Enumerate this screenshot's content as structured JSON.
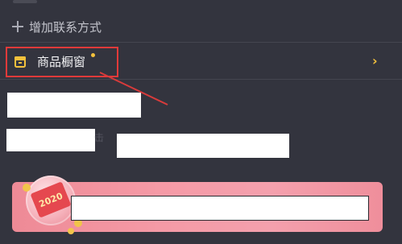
{
  "contact": {
    "add_label": "增加联系方式"
  },
  "shop_window": {
    "label": "商品橱窗",
    "chevron": "›",
    "icon": "shop-icon",
    "highlight_color": "#e23a3a",
    "accent_color": "#f3c13c"
  },
  "promo": {
    "badge_year": "2020"
  },
  "misc": {
    "partial_glyph": "击"
  }
}
